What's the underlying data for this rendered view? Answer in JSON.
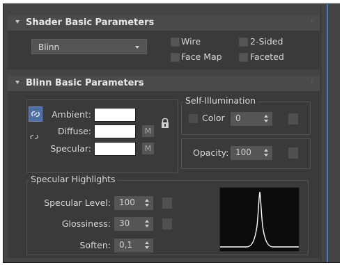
{
  "shader_rollout": {
    "title": "Shader Basic Parameters",
    "shader_value": "Blinn",
    "wire_label": "Wire",
    "two_sided_label": "2-Sided",
    "face_map_label": "Face Map",
    "faceted_label": "Faceted"
  },
  "blinn_rollout": {
    "title": "Blinn Basic Parameters",
    "ambient_label": "Ambient:",
    "diffuse_label": "Diffuse:",
    "specular_label": "Specular:",
    "diffuse_map_label": "M",
    "specular_map_label": "M",
    "self_illum": {
      "title": "Self-Illumination",
      "color_label": "Color",
      "color_value": "0"
    },
    "opacity": {
      "label": "Opacity:",
      "value": "100"
    },
    "specular_highlights": {
      "title": "Specular Highlights",
      "specular_level_label": "Specular Level:",
      "specular_level_value": "100",
      "glossiness_label": "Glossiness:",
      "glossiness_value": "30",
      "soften_label": "Soften:",
      "soften_value": "0,1"
    }
  },
  "colors": {
    "panel_bg": "#3a3a3a",
    "header_bg": "#4a4a4a",
    "swatch_color": "#ffffff",
    "accent_blue": "#3f7bbf",
    "highlight_curve": "#ffffff"
  },
  "icons": [
    "collapse-triangle-icon",
    "dropdown-arrow-icon",
    "lock-icon",
    "chain-link-icon",
    "spinner-arrows-icon"
  ]
}
